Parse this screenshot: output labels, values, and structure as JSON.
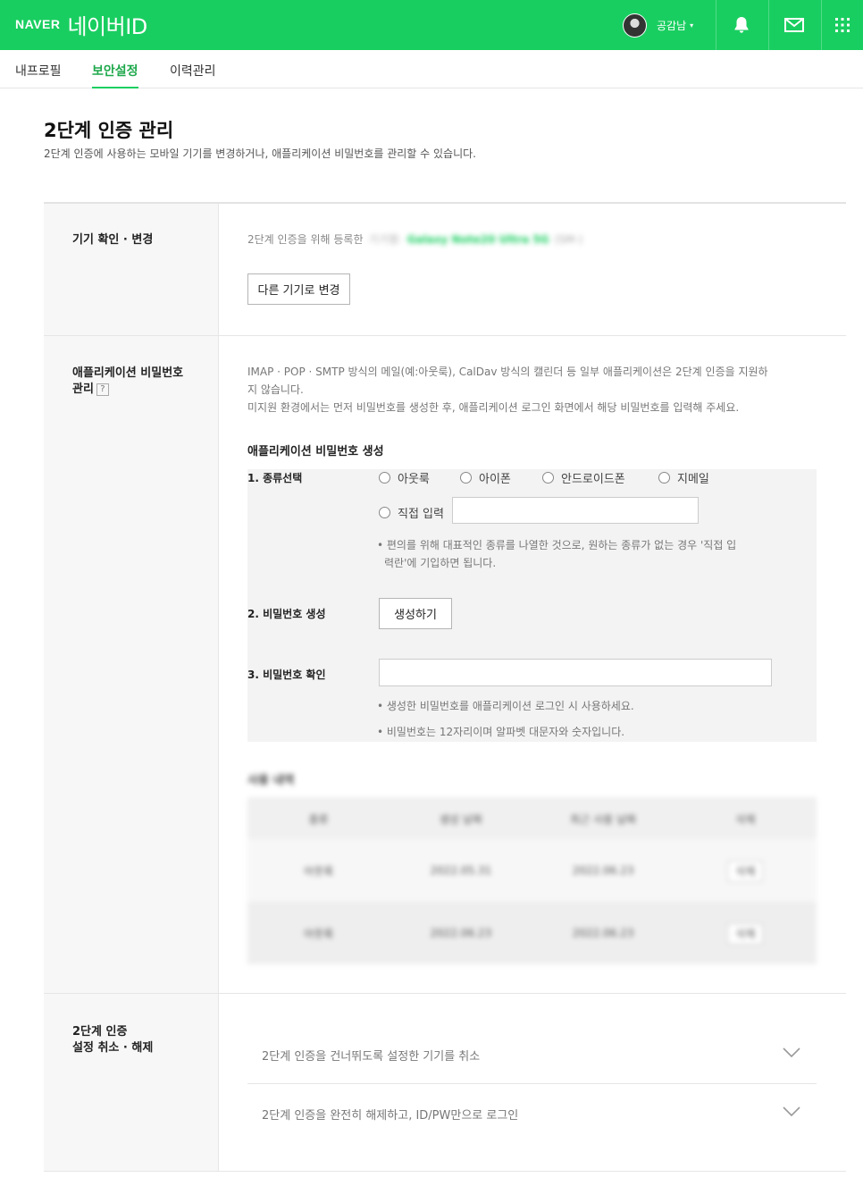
{
  "header": {
    "brand": "NAVER",
    "service": "네이버ID",
    "username": "공감남",
    "caret": "▾",
    "bg_color": "#19ce60"
  },
  "tabs": [
    {
      "label": "내프로필",
      "active": false
    },
    {
      "label": "보안설정",
      "active": true
    },
    {
      "label": "이력관리",
      "active": false
    }
  ],
  "page": {
    "title": "2단계 인증 관리",
    "description": "2단계 인증에 사용하는 모바일 기기를 변경하거나, 애플리케이션 비밀번호를 관리할 수 있습니다."
  },
  "device": {
    "label": "기기 확인 · 변경",
    "registered_text": "2단계 인증을 위해 등록한",
    "device_name": "Galaxy Note20 Ultra 5G",
    "change_button": "다른 기기로 변경"
  },
  "app_password": {
    "label_line1": "애플리케이션 비밀번호",
    "label_line2": "관리",
    "help": "?",
    "info_line1": "IMAP · POP · SMTP 방식의 메일(예:아웃룩), CalDav 방식의 캘린더 등 일부 애플리케이션은 2단계 인증을 지원하",
    "info_line2": "지 않습니다.",
    "info_line3": "미지원 환경에서는 먼저 비밀번호를 생성한 후, 애플리케이션 로그인 화면에서 해당 비밀번호를 입력해 주세요.",
    "generate_title": "애플리케이션 비밀번호 생성",
    "step1": "1. 종류선택",
    "options": [
      "아웃룩",
      "아이폰",
      "안드로이드폰",
      "지메일"
    ],
    "custom_option": "직접 입력",
    "note1_line1": "• 편의를 위해 대표적인 종류를 나열한 것으로, 원하는 종류가 없는 경우 '직접 입",
    "note1_line2": "력란'에 기입하면 됩니다.",
    "step2": "2. 비밀번호 생성",
    "generate_button": "생성하기",
    "step3": "3. 비밀번호 확인",
    "note2": "• 생성한 비밀번호를 애플리케이션 로그인 시 사용하세요.",
    "note3": "• 비밀번호는 12자리이며 알파벳 대문자와 숫자입니다."
  },
  "usage": {
    "title": "사용 내역",
    "headers": [
      "종류",
      "생성 날짜",
      "최근 사용 날짜",
      "삭제"
    ],
    "rows": [
      [
        "아웃룩",
        "2022.05.31",
        "2022.06.23",
        "삭제"
      ],
      [
        "아웃룩",
        "2022.06.23",
        "2022.06.23",
        "삭제"
      ]
    ]
  },
  "disable": {
    "label_line1": "2단계 인증",
    "label_line2": "설정 취소 · 해제",
    "items": [
      "2단계 인증을 건너뛰도록 설정한 기기를 취소",
      "2단계 인증을 완전히 해제하고, ID/PW만으로 로그인"
    ]
  }
}
